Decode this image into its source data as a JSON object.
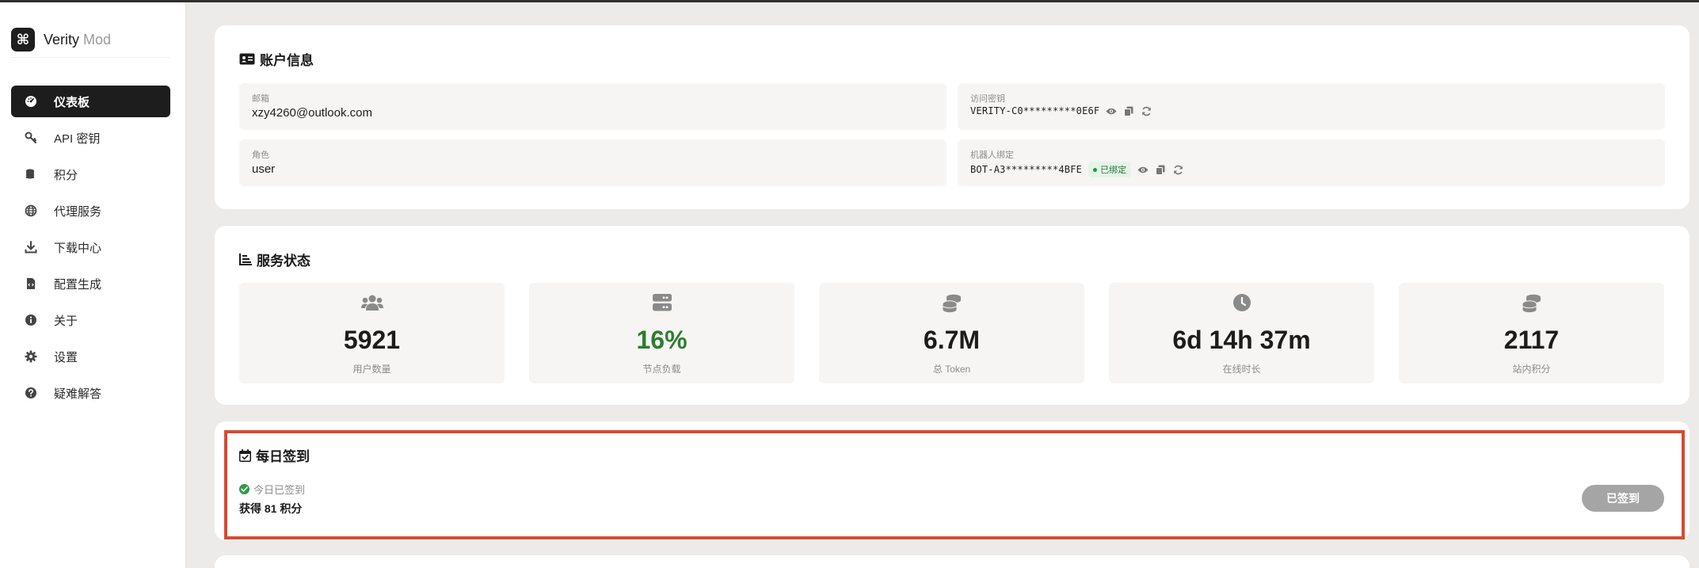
{
  "brand": {
    "logo_glyph": "⌘",
    "name": "Verity",
    "sub": "Mod"
  },
  "sidebar": {
    "items": [
      {
        "label": "仪表板",
        "icon": "dashboard-icon",
        "active": true
      },
      {
        "label": "API 密钥",
        "icon": "key-icon"
      },
      {
        "label": "积分",
        "icon": "coins-icon"
      },
      {
        "label": "代理服务",
        "icon": "globe-icon"
      },
      {
        "label": "下载中心",
        "icon": "download-icon"
      },
      {
        "label": "配置生成",
        "icon": "file-code-icon"
      },
      {
        "label": "关于",
        "icon": "info-icon"
      },
      {
        "label": "设置",
        "icon": "gear-icon"
      },
      {
        "label": "疑难解答",
        "icon": "question-icon"
      }
    ]
  },
  "account": {
    "title": "账户信息",
    "email_label": "邮箱",
    "email": "xzy4260@outlook.com",
    "role_label": "角色",
    "role": "user",
    "access_key_label": "访问密钥",
    "access_key": "VERITY-C0*********0E6F",
    "bot_label": "机器人绑定",
    "bot_value": "BOT-A3*********4BFE",
    "bot_badge": "已绑定"
  },
  "service": {
    "title": "服务状态",
    "stats": [
      {
        "value": "5921",
        "label": "用户数量",
        "icon": "users-icon"
      },
      {
        "value": "16%",
        "label": "节点负载",
        "icon": "server-icon"
      },
      {
        "value": "6.7M",
        "label": "总 Token",
        "icon": "coins-stack-icon"
      },
      {
        "value": "6d 14h 37m",
        "label": "在线时长",
        "icon": "clock-icon"
      },
      {
        "value": "2117",
        "label": "站内积分",
        "icon": "coins-stack-icon"
      }
    ]
  },
  "checkin": {
    "title": "每日签到",
    "status": "今日已签到",
    "reward": "获得 81 积分",
    "button": "已签到"
  },
  "colors": {
    "accent_dark": "#1d1d1d",
    "success": "#2e7d32",
    "highlight": "#d94a30"
  }
}
